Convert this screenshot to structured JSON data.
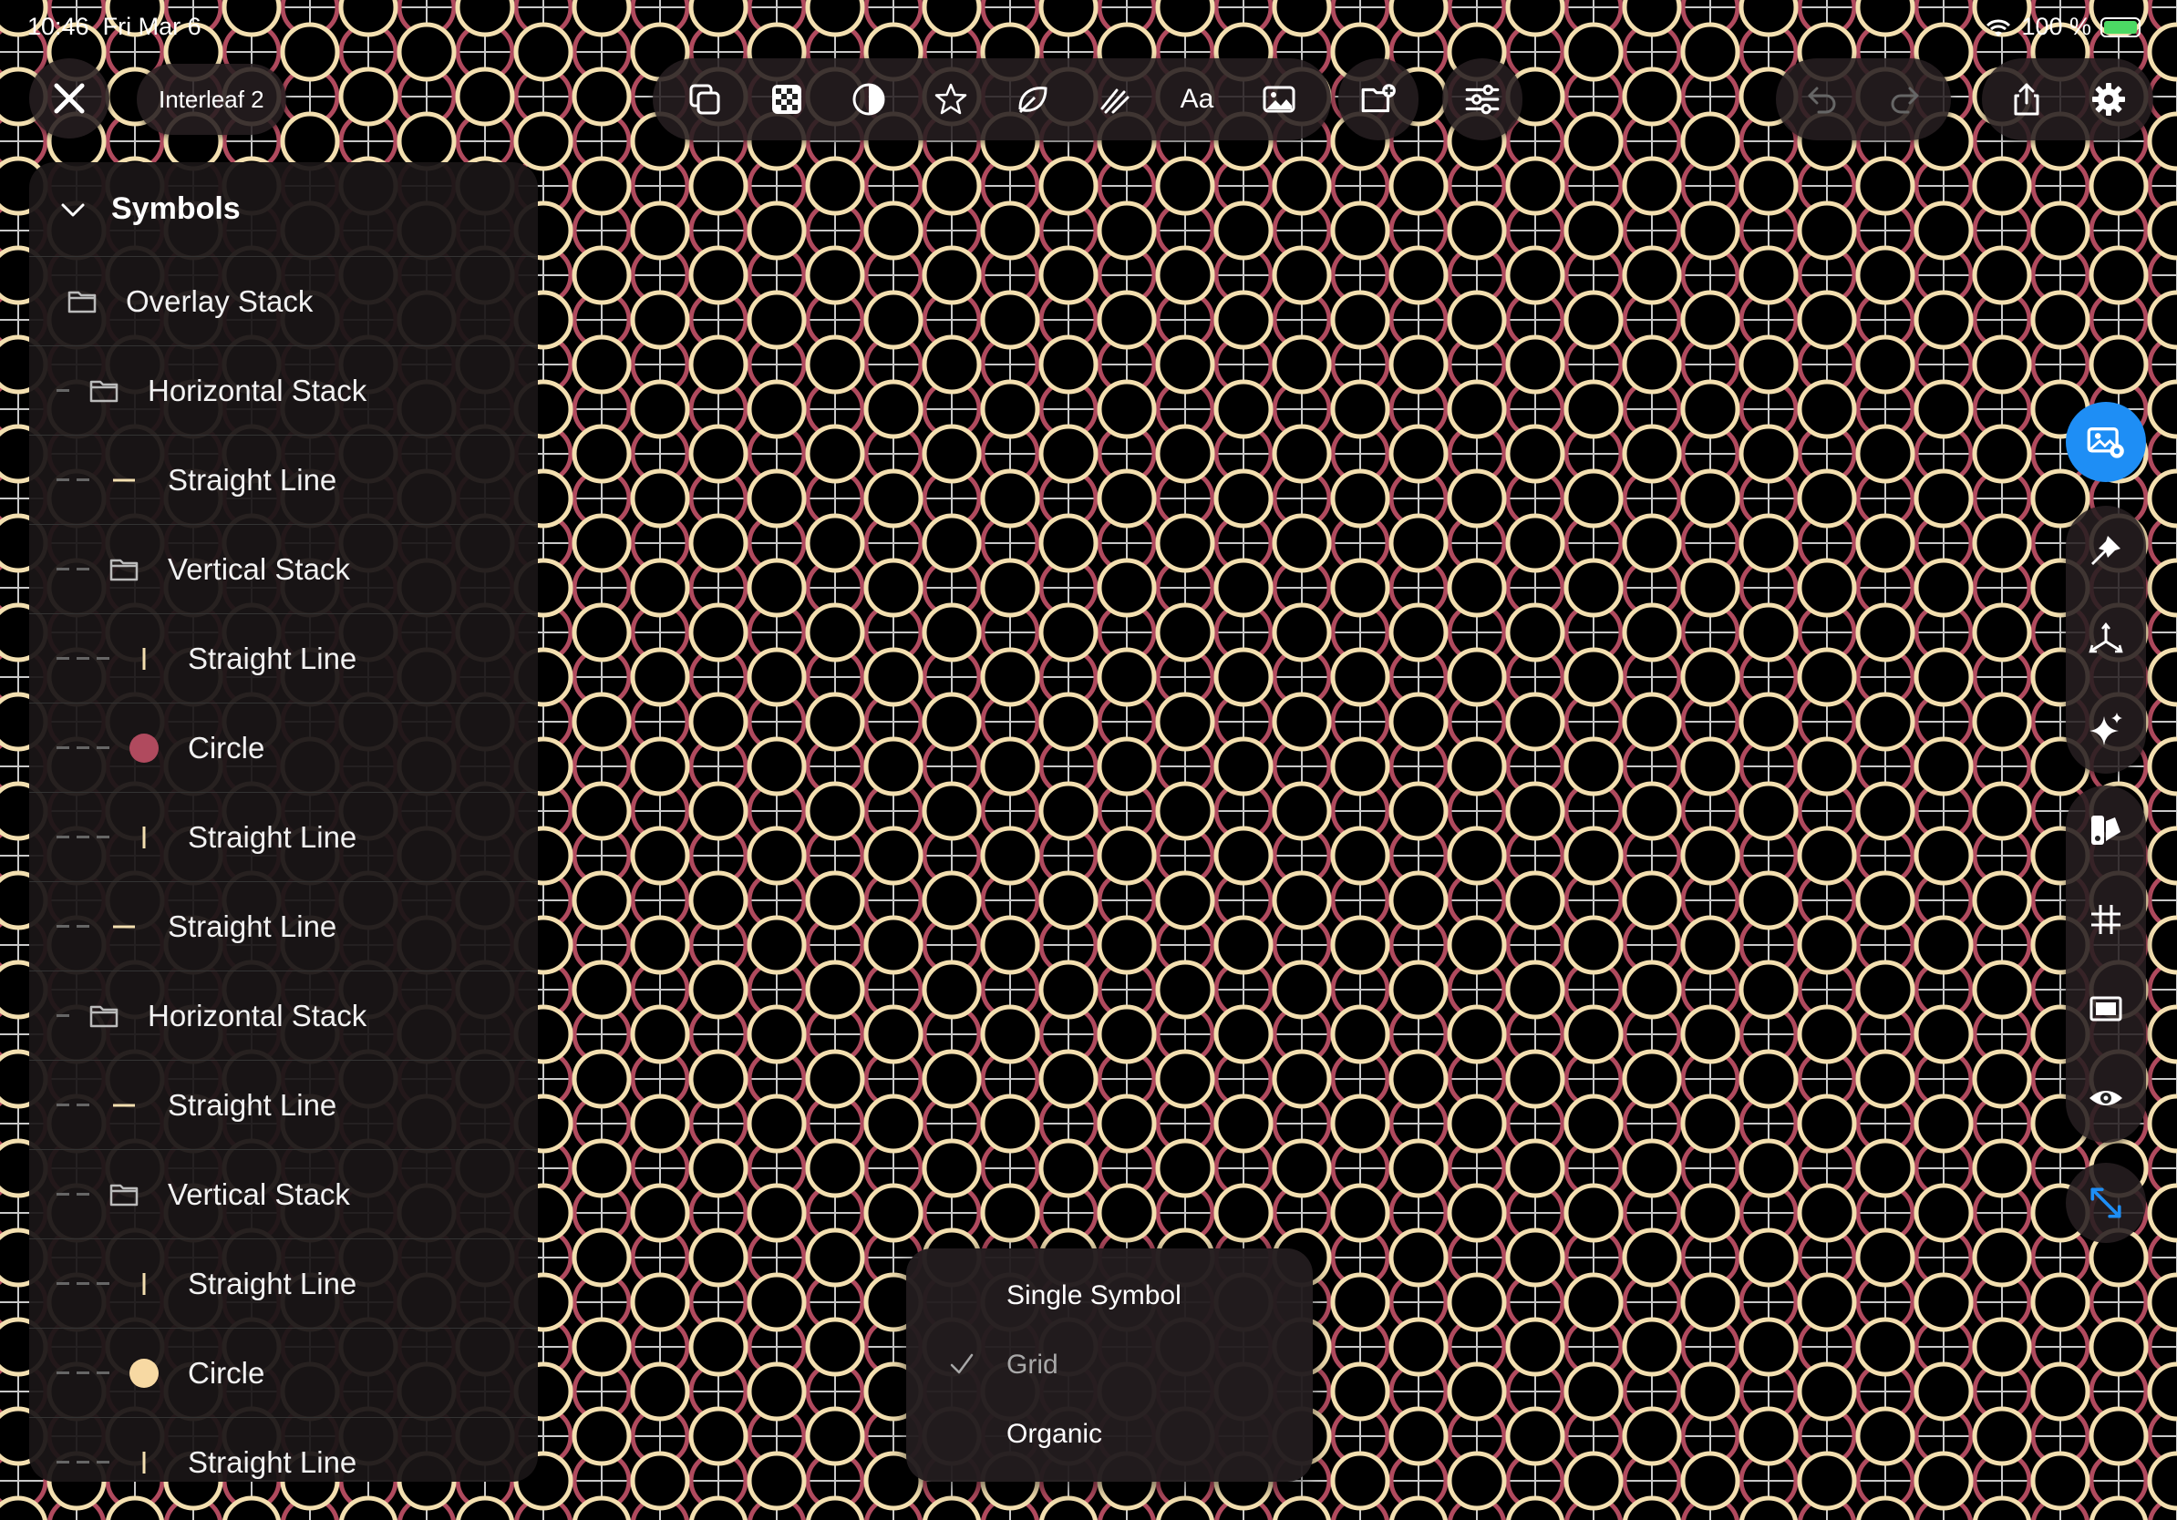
{
  "status_bar": {
    "time": "10:46",
    "date": "Fri Mar 6",
    "battery": "100 %"
  },
  "document": {
    "title": "Interleaf 2"
  },
  "toolbar": {
    "tools": [
      "duplicate-icon",
      "checkerboard-icon",
      "contrast-icon",
      "star-icon",
      "leaf-icon",
      "brush-icon",
      "text-icon",
      "image-icon"
    ],
    "text_tool_label": "Aa"
  },
  "symbols_panel": {
    "header": "Symbols",
    "rows": [
      {
        "label": "Overlay Stack",
        "depth": 0,
        "icon": "folder-icon"
      },
      {
        "label": "Horizontal Stack",
        "depth": 1,
        "icon": "folder-icon"
      },
      {
        "label": "Straight Line",
        "depth": 2,
        "icon": "horizontal-line-icon"
      },
      {
        "label": "Vertical Stack",
        "depth": 2,
        "icon": "folder-icon"
      },
      {
        "label": "Straight Line",
        "depth": 3,
        "icon": "vertical-line-icon"
      },
      {
        "label": "Circle",
        "depth": 3,
        "icon": "circle-swatch-icon",
        "color": "#b04a5e"
      },
      {
        "label": "Straight Line",
        "depth": 3,
        "icon": "vertical-line-icon"
      },
      {
        "label": "Straight Line",
        "depth": 2,
        "icon": "horizontal-line-icon"
      },
      {
        "label": "Horizontal Stack",
        "depth": 1,
        "icon": "folder-icon"
      },
      {
        "label": "Straight Line",
        "depth": 2,
        "icon": "horizontal-line-icon"
      },
      {
        "label": "Vertical Stack",
        "depth": 2,
        "icon": "folder-icon"
      },
      {
        "label": "Straight Line",
        "depth": 3,
        "icon": "vertical-line-icon"
      },
      {
        "label": "Circle",
        "depth": 3,
        "icon": "circle-swatch-icon",
        "color": "#f7d9a3"
      },
      {
        "label": "Straight Line",
        "depth": 3,
        "icon": "vertical-line-icon"
      }
    ]
  },
  "layout_menu": {
    "items": [
      {
        "label": "Single Symbol",
        "selected": false
      },
      {
        "label": "Grid",
        "selected": true
      },
      {
        "label": "Organic",
        "selected": false
      }
    ]
  },
  "colors": {
    "accent": "#1e8ef5",
    "pattern_cream": "#f3dfb0",
    "pattern_red": "#b04a5e",
    "grid_line": "#c9c9c9",
    "background": "#000000"
  }
}
